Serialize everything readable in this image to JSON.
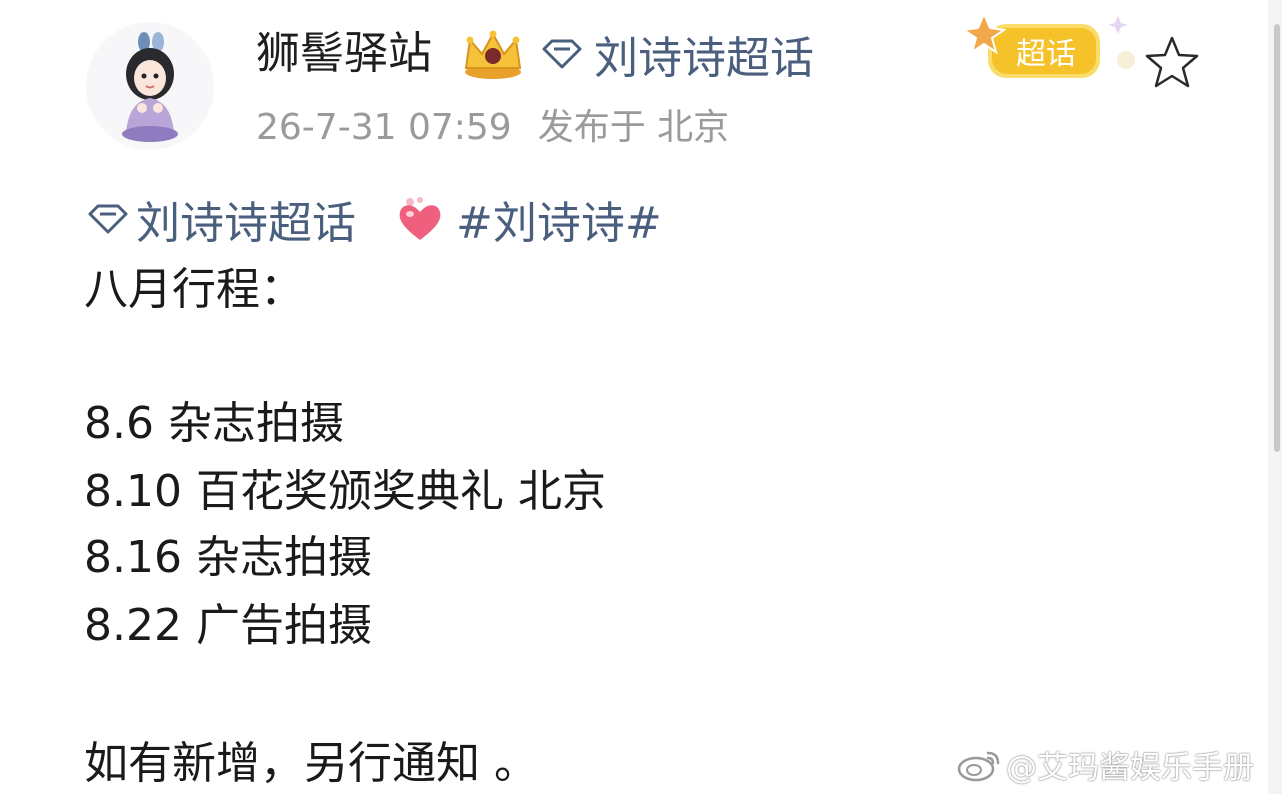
{
  "post": {
    "author_name": "狮髻驿站",
    "author_supertopic": "刘诗诗超话",
    "time": "26-7-31 07:59",
    "location": "发布于 北京",
    "badge_label": "超话",
    "topic_super": "刘诗诗超话",
    "hashtag": "#刘诗诗#",
    "lines": [
      "八月行程：",
      "8.6 杂志拍摄",
      "8.10 百花奖颁奖典礼 北京",
      "8.16 杂志拍摄",
      "8.22 广告拍摄",
      "如有新增，另行通知 。"
    ]
  },
  "watermark": "@艾玛酱娱乐手册",
  "icons": {
    "avatar": "avatar-icon",
    "crown": "crown-icon",
    "diamond": "diamond-icon",
    "badge": "supertopic-badge-icon",
    "star": "star-icon",
    "heart": "heart-icon",
    "weibo": "weibo-logo-icon"
  },
  "colors": {
    "link": "#4a5e7e",
    "meta": "#9a9a9a",
    "text": "#1a1a1a",
    "badge": "#f5c22a"
  }
}
